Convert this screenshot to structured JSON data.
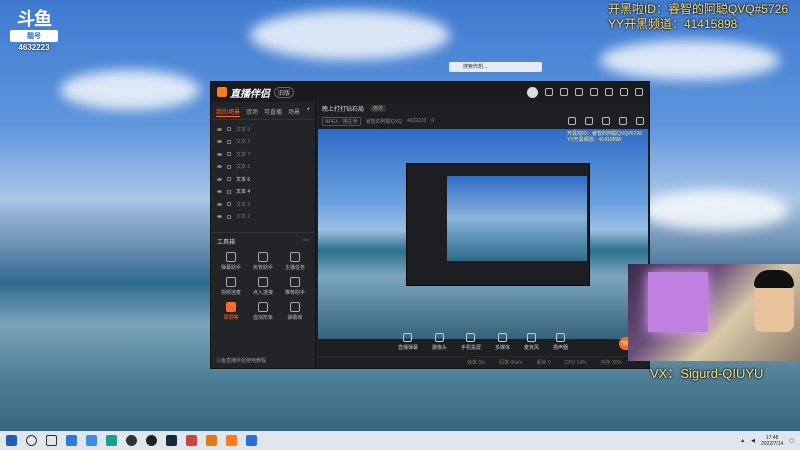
{
  "overlay": {
    "logo": "斗鱼",
    "badge": "靓号",
    "room_number": "4632223",
    "top_right_line1": "开黑啦ID：睿智的阿聪QVQ#5726",
    "top_right_line2": "YY开黑频道：41415898",
    "vx": "VX：Sigurd-QIUYU"
  },
  "app": {
    "brand": "直播伴侣",
    "version": "旧版",
    "tabs": [
      "我的场景",
      "双场",
      "可直播",
      "场景"
    ],
    "active_tab_index": 0,
    "scenes": [
      {
        "label": "文本 5",
        "on": false
      },
      {
        "label": "文本 2",
        "on": false
      },
      {
        "label": "文本 7",
        "on": false
      },
      {
        "label": "文本 1",
        "on": false
      },
      {
        "label": "文本 6",
        "on": true
      },
      {
        "label": "文本 4",
        "on": true
      },
      {
        "label": "文本 3",
        "on": false
      },
      {
        "label": "文本 2",
        "on": false
      }
    ],
    "tools_header": "工具箱",
    "tools": [
      {
        "label": "弹幕助手",
        "highlight": false
      },
      {
        "label": "房管助手",
        "highlight": false
      },
      {
        "label": "主播任务",
        "highlight": false
      },
      {
        "label": "视频连麦",
        "highlight": false
      },
      {
        "label": "点入连接",
        "highlight": false
      },
      {
        "label": "推荐助手",
        "highlight": false
      },
      {
        "label": "录屏等",
        "highlight": true
      },
      {
        "label": "虚拟形象",
        "highlight": false
      },
      {
        "label": "弹幕库",
        "highlight": false
      }
    ],
    "tip": "斗鱼直播伴侣使用教程",
    "room_title": "晚上打打钻石局",
    "room_edit": "修改",
    "category": "APEX · 格在参",
    "streamer": "睿智的阿聪QVQ",
    "room_id": "4632223",
    "likes": "0",
    "bottom_tools": [
      "直播弹幕",
      "摄像头",
      "手机投屏",
      "多媒体",
      "麦克风",
      "扬声器"
    ],
    "start_label": "开始直播",
    "status_items": [
      "帧率 0/s",
      "码率 0kb/s",
      "丢帧 0",
      "CPU 14%",
      "内存 30%"
    ]
  },
  "mini_search": "搜索你想...",
  "taskbar": {
    "time": "17:48",
    "date": "2022/7/14"
  }
}
